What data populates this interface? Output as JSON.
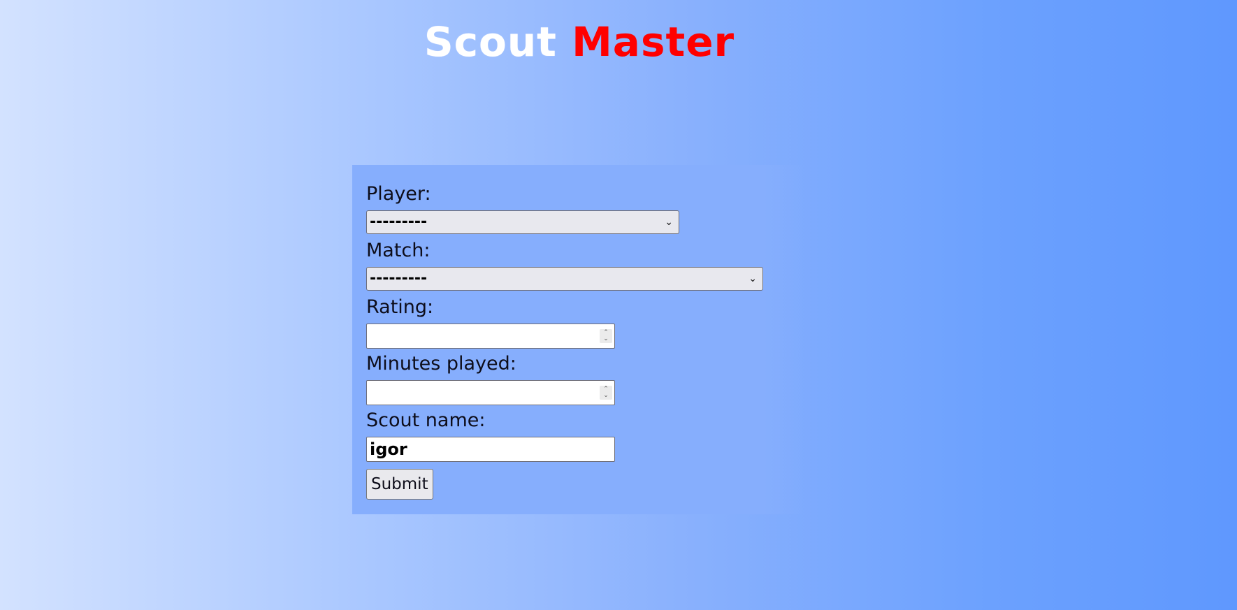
{
  "header": {
    "title_part1": "Scout",
    "title_part2": "Master"
  },
  "form": {
    "player": {
      "label": "Player:",
      "selected": "---------"
    },
    "match": {
      "label": "Match:",
      "selected": "---------"
    },
    "rating": {
      "label": "Rating:",
      "value": ""
    },
    "minutes_played": {
      "label": "Minutes played:",
      "value": ""
    },
    "scout_name": {
      "label": "Scout name:",
      "value": "igor"
    },
    "submit_label": "Submit"
  },
  "colors": {
    "title_primary": "#ffffff",
    "title_accent": "#ff0000",
    "panel_background": "#86aefd"
  }
}
